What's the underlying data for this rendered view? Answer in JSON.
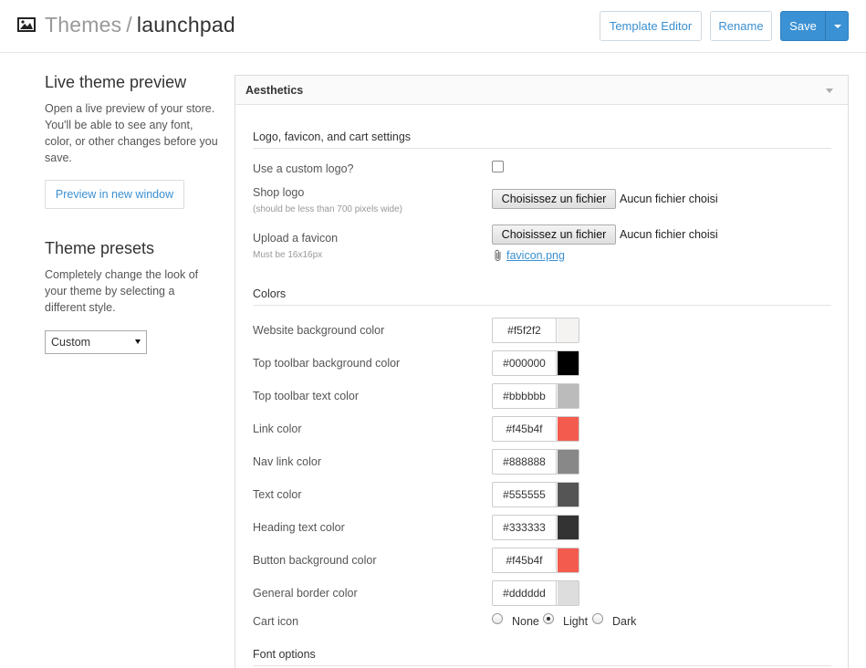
{
  "header": {
    "section": "Themes",
    "separator": "/",
    "current": "launchpad",
    "template_editor_label": "Template Editor",
    "rename_label": "Rename",
    "save_label": "Save"
  },
  "sidebar": {
    "preview_heading": "Live theme preview",
    "preview_desc": "Open a live preview of your store. You'll be able to see any font, color, or other changes before you save.",
    "preview_button": "Preview in new window",
    "presets_heading": "Theme presets",
    "presets_desc": "Completely change the look of your theme by selecting a different style.",
    "presets_selected": "Custom"
  },
  "panel": {
    "title": "Aesthetics",
    "logo_section": "Logo, favicon, and cart settings",
    "custom_logo_label": "Use a custom logo?",
    "custom_logo_checked": false,
    "shop_logo_label": "Shop logo",
    "shop_logo_hint": "(should be less than 700 pixels wide)",
    "file_button": "Choisissez un fichier",
    "file_none": "Aucun fichier choisi",
    "favicon_label": "Upload a favicon",
    "favicon_hint": "Must be 16x16px",
    "favicon_file": "favicon.png",
    "colors_section": "Colors",
    "colors": [
      {
        "label": "Website background color",
        "hex": "#f5f2f2",
        "swatch": "#f5f2f2"
      },
      {
        "label": "Top toolbar background color",
        "hex": "#000000",
        "swatch": "#000000"
      },
      {
        "label": "Top toolbar text color",
        "hex": "#bbbbbb",
        "swatch": "#bbbbbb"
      },
      {
        "label": "Link color",
        "hex": "#f45b4f",
        "swatch": "#f45b4f"
      },
      {
        "label": "Nav link color",
        "hex": "#888888",
        "swatch": "#888888"
      },
      {
        "label": "Text color",
        "hex": "#555555",
        "swatch": "#555555"
      },
      {
        "label": "Heading text color",
        "hex": "#333333",
        "swatch": "#333333"
      },
      {
        "label": "Button background color",
        "hex": "#f45b4f",
        "swatch": "#f45b4f"
      },
      {
        "label": "General border color",
        "hex": "#dddddd",
        "swatch": "#dddddd"
      }
    ],
    "cart_icon_label": "Cart icon",
    "cart_icon_options": [
      "None",
      "Light",
      "Dark"
    ],
    "cart_icon_selected": "Light",
    "font_section": "Font options"
  },
  "icons": {
    "header": "image-icon",
    "attachment": "paperclip-icon"
  }
}
